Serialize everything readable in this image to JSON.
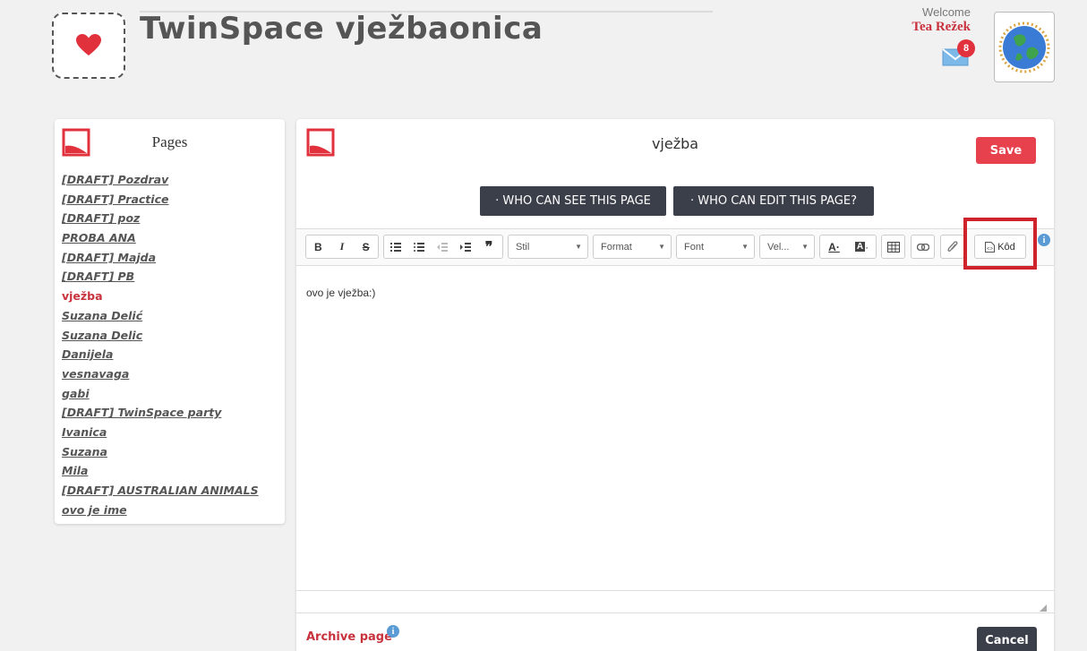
{
  "header": {
    "site_title": "TwinSpace vježbaonica",
    "welcome_label": "Welcome",
    "username": "Tea Režek",
    "mail_badge_count": "8"
  },
  "sidebar": {
    "title": "Pages",
    "items": [
      {
        "label": "[DRAFT] Pozdrav",
        "active": false
      },
      {
        "label": "[DRAFT] Practice",
        "active": false
      },
      {
        "label": "[DRAFT] poz",
        "active": false
      },
      {
        "label": "PROBA ANA",
        "active": false
      },
      {
        "label": "[DRAFT] Majda",
        "active": false
      },
      {
        "label": "[DRAFT] PB",
        "active": false
      },
      {
        "label": "vježba",
        "active": true
      },
      {
        "label": "Suzana Delić",
        "active": false
      },
      {
        "label": "Suzana Delic",
        "active": false
      },
      {
        "label": "Danijela",
        "active": false
      },
      {
        "label": "vesnavaga",
        "active": false
      },
      {
        "label": "gabi",
        "active": false
      },
      {
        "label": "[DRAFT] TwinSpace party",
        "active": false
      },
      {
        "label": "Ivanica",
        "active": false
      },
      {
        "label": "Suzana",
        "active": false
      },
      {
        "label": "Mila",
        "active": false
      },
      {
        "label": "[DRAFT] AUSTRALIAN ANIMALS",
        "active": false
      },
      {
        "label": "ovo je ime",
        "active": false
      }
    ]
  },
  "editor": {
    "page_name": "vježba",
    "save_label": "Save",
    "who_can_see_label": "· WHO CAN SEE THIS PAGE",
    "who_can_edit_label": "· WHO CAN EDIT THIS PAGE?",
    "toolbar": {
      "bold": "B",
      "italic": "I",
      "strike": "S",
      "style_select": "Stil",
      "format_select": "Format",
      "font_select": "Font",
      "size_select": "Vel...",
      "source_label": "Kôd"
    },
    "content_text": "ovo je vježba:)",
    "archive_label": "Archive page",
    "cancel_label": "Cancel"
  },
  "colors": {
    "accent_red": "#e8414e",
    "dark_button": "#3b3f4a",
    "link_red": "#c8323d",
    "highlight_box": "#d0222b"
  }
}
